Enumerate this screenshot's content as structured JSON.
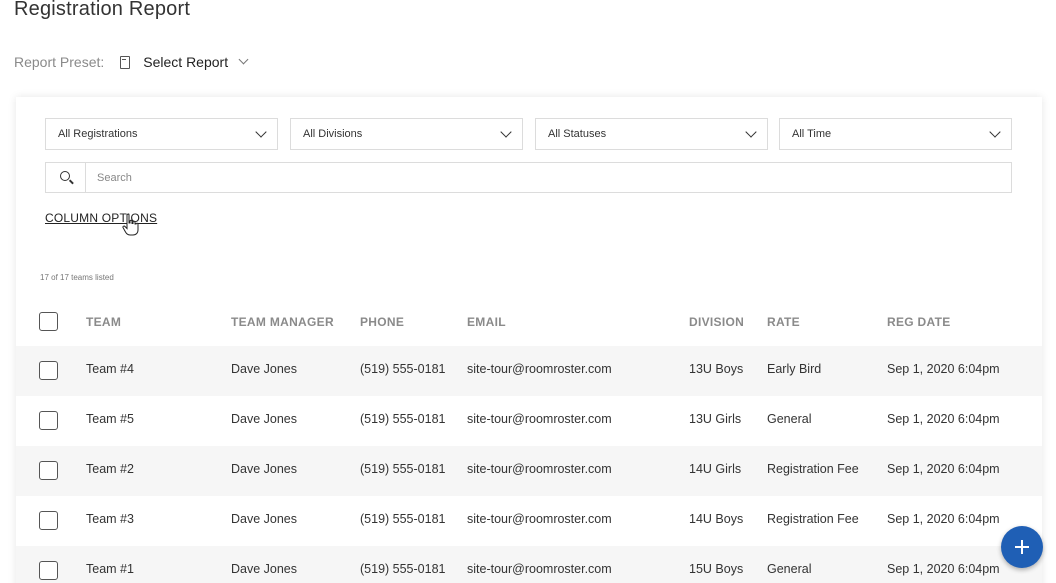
{
  "page": {
    "title": "Registration Report"
  },
  "preset": {
    "label": "Report Preset:",
    "value": "Select Report"
  },
  "filters": {
    "registrations": "All Registrations",
    "divisions": "All Divisions",
    "statuses": "All Statuses",
    "time": "All Time"
  },
  "search": {
    "placeholder": "Search"
  },
  "column_options_label": "COLUMN OPTIONS",
  "count_text": "17 of 17 teams listed",
  "table": {
    "headers": [
      "TEAM",
      "TEAM MANAGER",
      "PHONE",
      "EMAIL",
      "DIVISION",
      "RATE",
      "REG DATE"
    ],
    "rows": [
      [
        "Team #4",
        "Dave Jones",
        "(519) 555-0181",
        "site-tour@roomroster.com",
        "13U Boys",
        "Early Bird",
        "Sep 1, 2020 6:04pm"
      ],
      [
        "Team #5",
        "Dave Jones",
        "(519) 555-0181",
        "site-tour@roomroster.com",
        "13U Girls",
        "General",
        "Sep 1, 2020 6:04pm"
      ],
      [
        "Team #2",
        "Dave Jones",
        "(519) 555-0181",
        "site-tour@roomroster.com",
        "14U Girls",
        "Registration Fee",
        "Sep 1, 2020 6:04pm"
      ],
      [
        "Team #3",
        "Dave Jones",
        "(519) 555-0181",
        "site-tour@roomroster.com",
        "14U Boys",
        "Registration Fee",
        "Sep 1, 2020 6:04pm"
      ],
      [
        "Team #1",
        "Dave Jones",
        "(519) 555-0181",
        "site-tour@roomroster.com",
        "15U Boys",
        "General",
        "Sep 1, 2020 6:04pm"
      ]
    ]
  },
  "colors": {
    "accent": "#1f5fb5",
    "row_alt": "#f6f6f6",
    "header_text": "#8a8a8a"
  },
  "icons": {
    "fab": "plus-icon",
    "search": "search-icon",
    "preset": "document-icon"
  }
}
